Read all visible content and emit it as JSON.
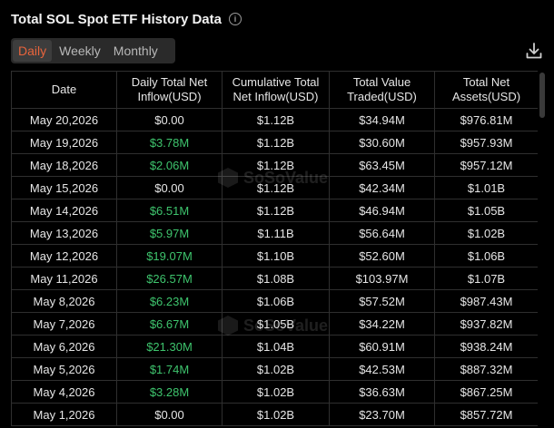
{
  "header": {
    "title": "Total SOL Spot ETF History Data",
    "info_icon": "i"
  },
  "tabs": [
    {
      "label": "Daily",
      "active": true
    },
    {
      "label": "Weekly",
      "active": false
    },
    {
      "label": "Monthly",
      "active": false
    }
  ],
  "download_icon": "download-icon",
  "colors": {
    "accent": "#e8643c",
    "positive": "#3ec46d",
    "background": "#000000"
  },
  "watermark": "SoSoValue",
  "table": {
    "columns": [
      "Date",
      "Daily Total Net Inflow(USD)",
      "Cumulative Total Net Inflow(USD)",
      "Total Value Traded(USD)",
      "Total Net Assets(USD)"
    ],
    "rows": [
      {
        "date": "May 20,2026",
        "inflow": "$0.00",
        "positive": false,
        "cumulative": "$1.12B",
        "traded": "$34.94M",
        "assets": "$976.81M"
      },
      {
        "date": "May 19,2026",
        "inflow": "$3.78M",
        "positive": true,
        "cumulative": "$1.12B",
        "traded": "$30.60M",
        "assets": "$957.93M"
      },
      {
        "date": "May 18,2026",
        "inflow": "$2.06M",
        "positive": true,
        "cumulative": "$1.12B",
        "traded": "$63.45M",
        "assets": "$957.12M"
      },
      {
        "date": "May 15,2026",
        "inflow": "$0.00",
        "positive": false,
        "cumulative": "$1.12B",
        "traded": "$42.34M",
        "assets": "$1.01B"
      },
      {
        "date": "May 14,2026",
        "inflow": "$6.51M",
        "positive": true,
        "cumulative": "$1.12B",
        "traded": "$46.94M",
        "assets": "$1.05B"
      },
      {
        "date": "May 13,2026",
        "inflow": "$5.97M",
        "positive": true,
        "cumulative": "$1.11B",
        "traded": "$56.64M",
        "assets": "$1.02B"
      },
      {
        "date": "May 12,2026",
        "inflow": "$19.07M",
        "positive": true,
        "cumulative": "$1.10B",
        "traded": "$52.60M",
        "assets": "$1.06B"
      },
      {
        "date": "May 11,2026",
        "inflow": "$26.57M",
        "positive": true,
        "cumulative": "$1.08B",
        "traded": "$103.97M",
        "assets": "$1.07B"
      },
      {
        "date": "May 8,2026",
        "inflow": "$6.23M",
        "positive": true,
        "cumulative": "$1.06B",
        "traded": "$57.52M",
        "assets": "$987.43M"
      },
      {
        "date": "May 7,2026",
        "inflow": "$6.67M",
        "positive": true,
        "cumulative": "$1.05B",
        "traded": "$34.22M",
        "assets": "$937.82M"
      },
      {
        "date": "May 6,2026",
        "inflow": "$21.30M",
        "positive": true,
        "cumulative": "$1.04B",
        "traded": "$60.91M",
        "assets": "$938.24M"
      },
      {
        "date": "May 5,2026",
        "inflow": "$1.74M",
        "positive": true,
        "cumulative": "$1.02B",
        "traded": "$42.53M",
        "assets": "$887.32M"
      },
      {
        "date": "May 4,2026",
        "inflow": "$3.28M",
        "positive": true,
        "cumulative": "$1.02B",
        "traded": "$36.63M",
        "assets": "$867.25M"
      },
      {
        "date": "May 1,2026",
        "inflow": "$0.00",
        "positive": false,
        "cumulative": "$1.02B",
        "traded": "$23.70M",
        "assets": "$857.72M"
      }
    ]
  }
}
